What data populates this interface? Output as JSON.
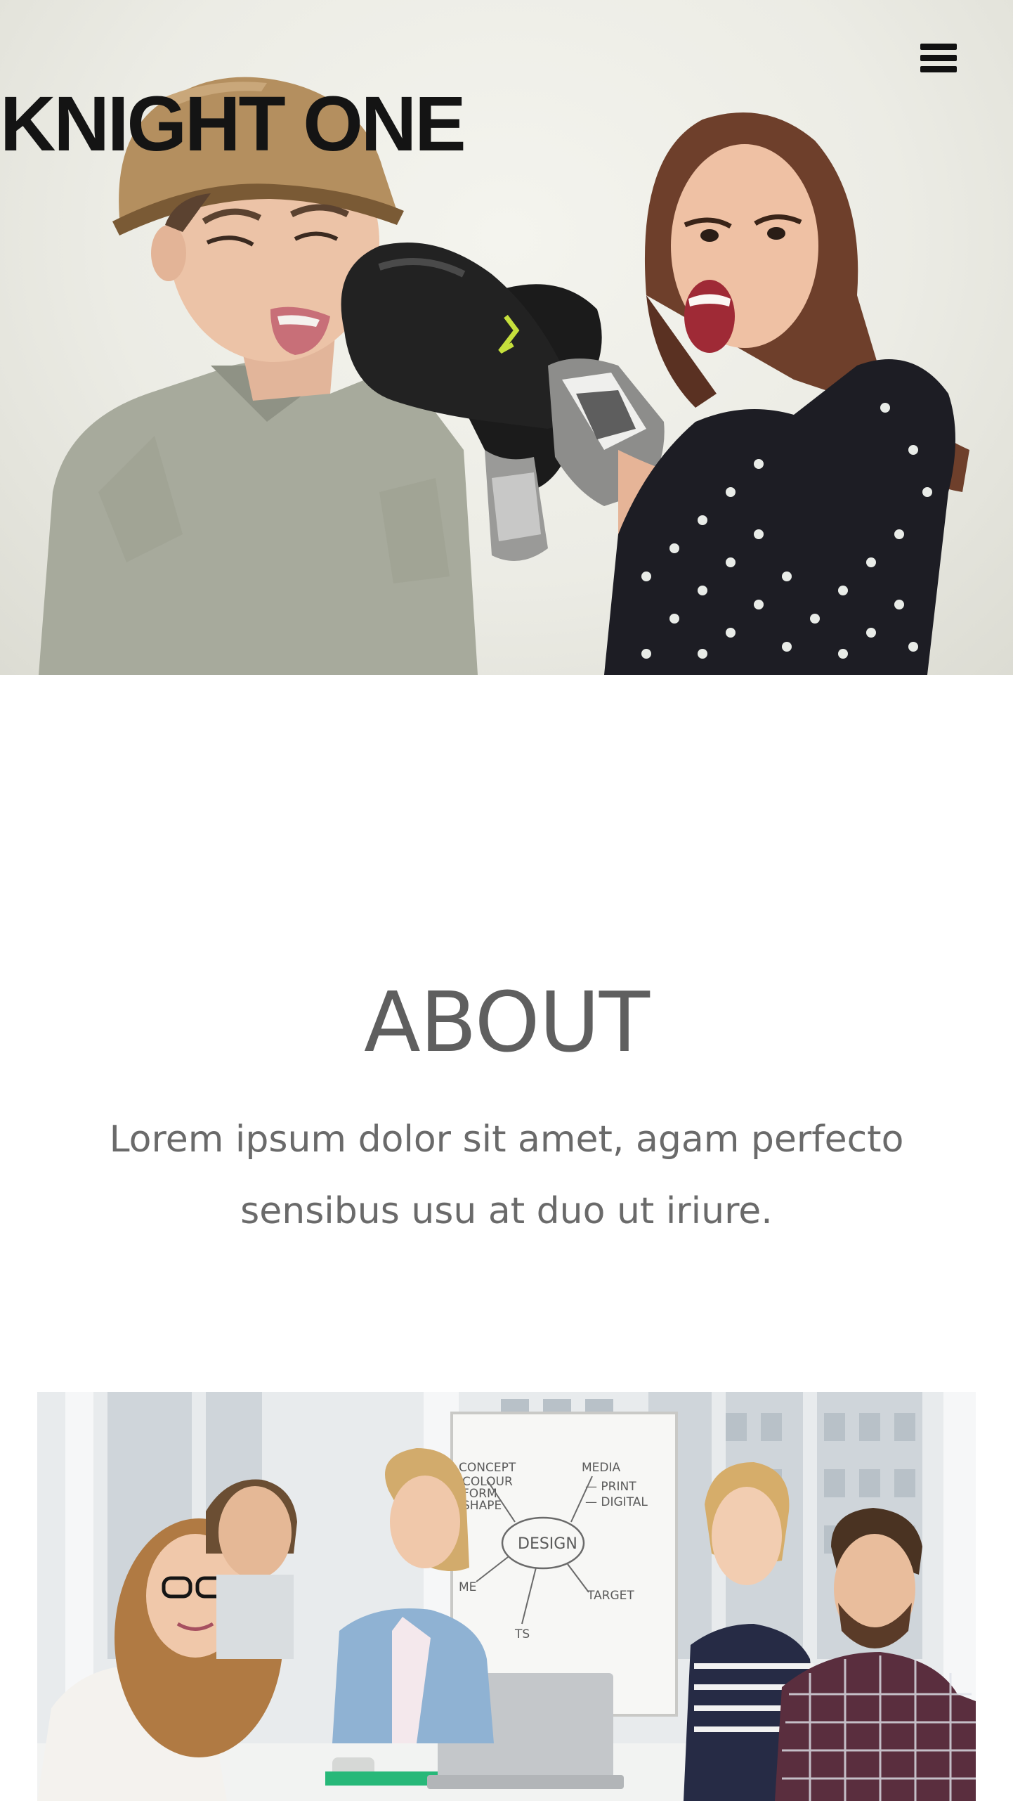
{
  "header": {
    "brand": "KNIGHT ONE",
    "menu_icon": "hamburger-menu-icon"
  },
  "hero": {
    "image_alt": "Woman in polka-dot dress punching a man in a hat with a black boxing glove"
  },
  "about": {
    "title": "ABOUT",
    "text": "Lorem ipsum dolor sit amet, agam perfecto sensibus usu at duo ut iriure."
  },
  "team_image": {
    "image_alt": "Team of five smiling colleagues around a table in front of a design whiteboard",
    "whiteboard": {
      "concept": "CONCEPT",
      "colour": "COLOUR",
      "form": "FORM",
      "shape": "SHAPE",
      "media": "MEDIA",
      "print": "— PRINT",
      "digital": "— DIGITAL",
      "design": "DESIGN",
      "target": "TARGET",
      "time": "ME",
      "cost": "TS"
    }
  },
  "colors": {
    "brand_text": "#141414",
    "heading": "#5f5f5f",
    "body_text": "#6a6a6a",
    "background": "#ffffff"
  }
}
